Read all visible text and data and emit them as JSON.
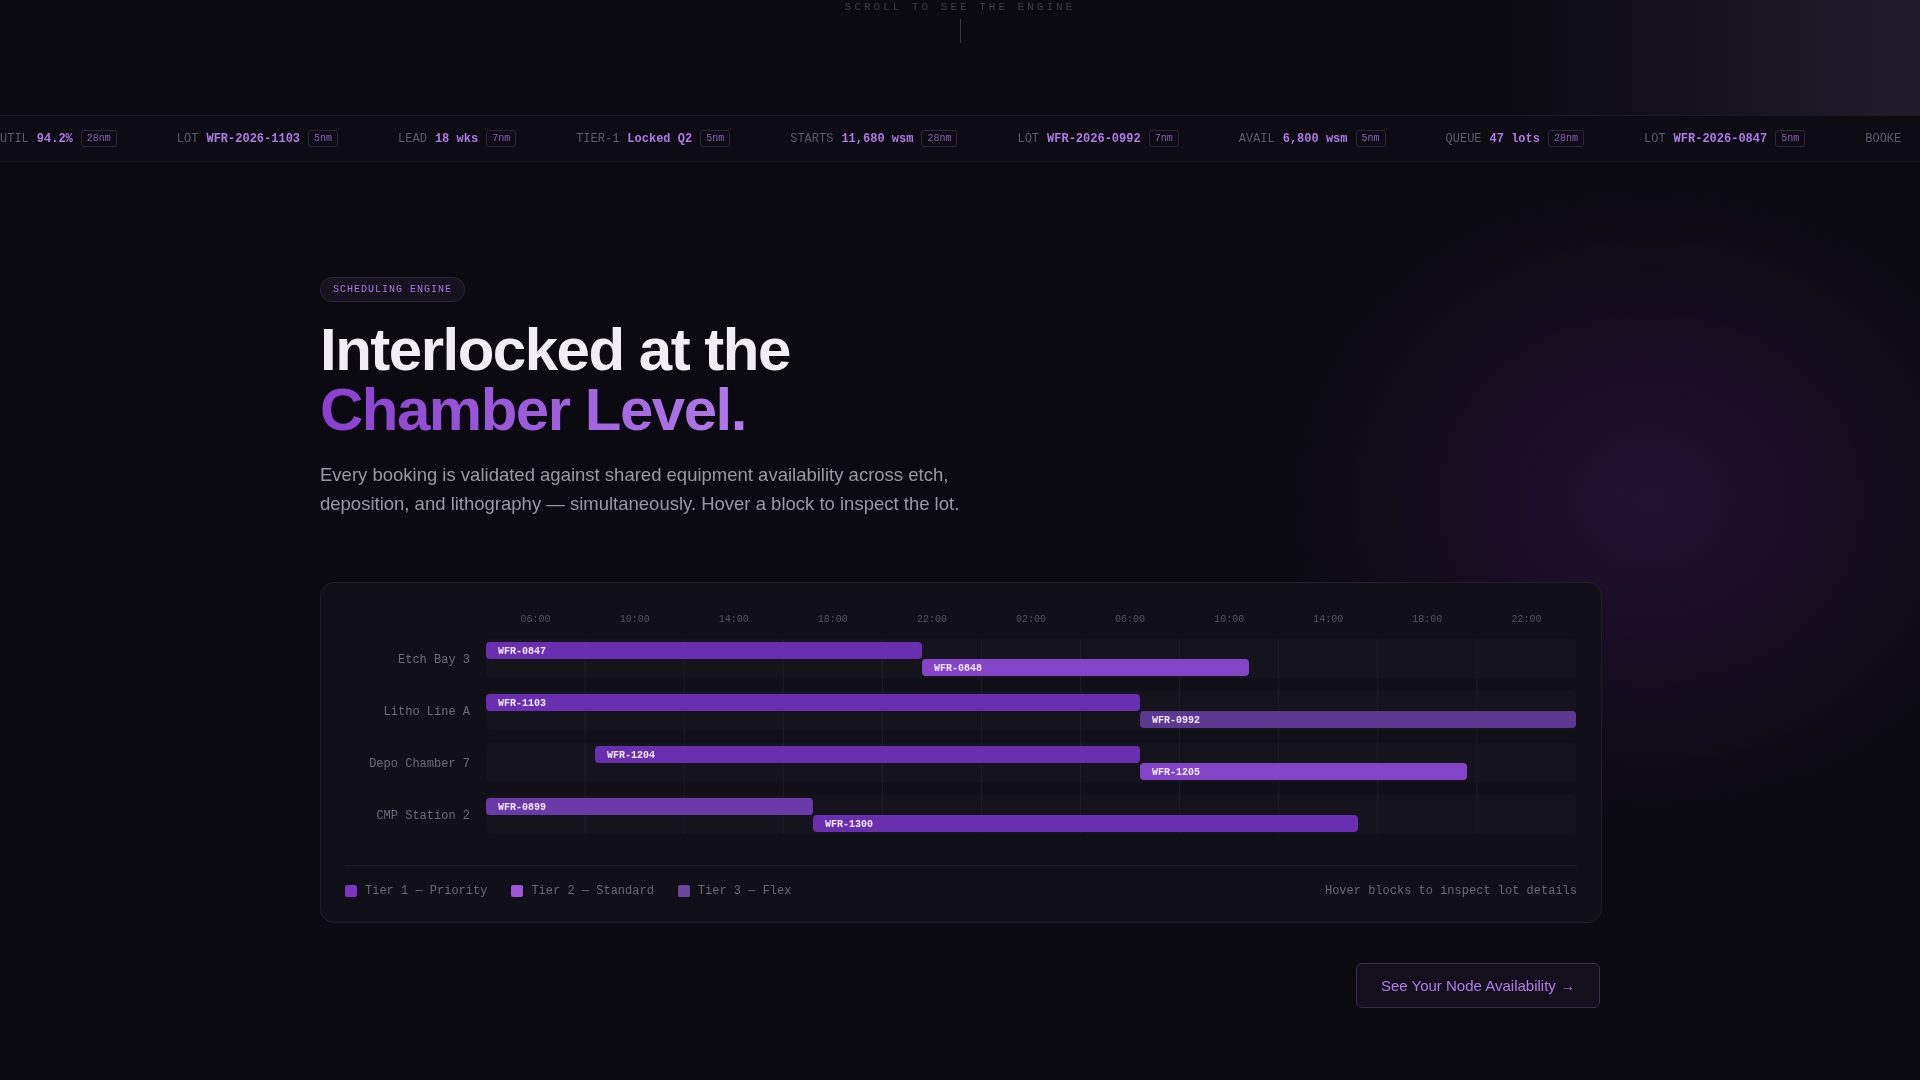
{
  "scroll_hint": {
    "text": "SCROLL TO SEE THE ENGINE"
  },
  "ticker": [
    {
      "label": "UTIL",
      "value": "94.2%",
      "node": "28nm"
    },
    {
      "label": "LOT",
      "value": "WFR-2026-1103",
      "node": "5nm"
    },
    {
      "label": "LEAD",
      "value": "18 wks",
      "node": "7nm"
    },
    {
      "label": "TIER-1",
      "value": "Locked Q2",
      "node": "5nm"
    },
    {
      "label": "STARTS",
      "value": "11,680 wsm",
      "node": "28nm"
    },
    {
      "label": "LOT",
      "value": "WFR-2026-0992",
      "node": "7nm"
    },
    {
      "label": "AVAIL",
      "value": "6,800 wsm",
      "node": "5nm"
    },
    {
      "label": "QUEUE",
      "value": "47 lots",
      "node": "28nm"
    },
    {
      "label": "LOT",
      "value": "WFR-2026-0847",
      "node": "5nm"
    },
    {
      "label": "BOOKE"
    }
  ],
  "hero": {
    "tag": "SCHEDULING ENGINE",
    "title_line_1": "Interlocked at the",
    "title_line_2": "Chamber Level.",
    "description": "Every booking is validated against shared equipment availability across etch, deposition, and lithography — simultaneously. Hover a block to inspect the lot."
  },
  "schedule": {
    "time_axis": [
      "06:00",
      "10:00",
      "14:00",
      "18:00",
      "22:00",
      "02:00",
      "06:00",
      "10:00",
      "14:00",
      "18:00",
      "22:00"
    ],
    "lanes": [
      {
        "name": "Etch Bay 3",
        "blocks": [
          {
            "label": "WFR-0847",
            "color": "#6a2fb0"
          },
          {
            "label": "WFR-0848",
            "color": "#8444c8"
          }
        ]
      },
      {
        "name": "Litho Line A",
        "blocks": [
          {
            "label": "WFR-1103",
            "color": "#6a2fb0"
          },
          {
            "label": "WFR-0992",
            "color": "#5c3890"
          }
        ]
      },
      {
        "name": "Depo Chamber 7",
        "blocks": [
          {
            "label": "WFR-1204",
            "color": "#6a2fb0"
          },
          {
            "label": "WFR-1205",
            "color": "#8444c8"
          }
        ]
      },
      {
        "name": "CMP Station 2",
        "blocks": [
          {
            "label": "WFR-0899",
            "color": "#6c3aa8"
          },
          {
            "label": "WFR-1300",
            "color": "#6a2fb0"
          }
        ]
      }
    ],
    "legend": [
      {
        "label": "Tier 1 — Priority",
        "color": "#7a35c4"
      },
      {
        "label": "Tier 2 — Standard",
        "color": "#9d55dc"
      },
      {
        "label": "Tier 3 — Flex",
        "color": "#6c45a0"
      }
    ],
    "hint": "Hover blocks to inspect lot details"
  },
  "cta": {
    "label": "See Your Node Availability →"
  }
}
